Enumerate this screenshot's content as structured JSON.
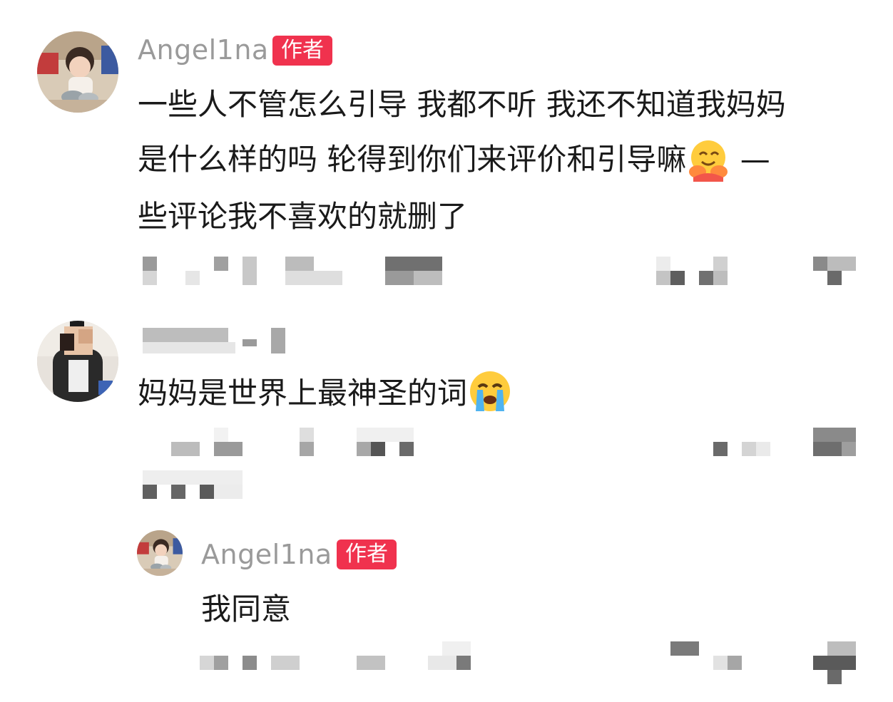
{
  "comments": [
    {
      "username": "Angel1na",
      "badge": "作者",
      "lines": [
        "一些人不管怎么引导 我都不听 我还不知道我妈妈",
        "是什么样的吗 轮得到你们来评价和引导嘛",
        "—",
        "些评论我不喜欢的就删了"
      ],
      "emoji": "hugging-face"
    },
    {
      "text": "妈妈是世界上最神圣的词",
      "emoji": "loudly-crying-face"
    },
    {
      "username": "Angel1na",
      "badge": "作者",
      "text": "我同意"
    }
  ],
  "colors": {
    "badge": "#f0324e",
    "username": "#9a9a9a",
    "text": "#1a1a1a",
    "pixelated": "#8c8c8c"
  }
}
